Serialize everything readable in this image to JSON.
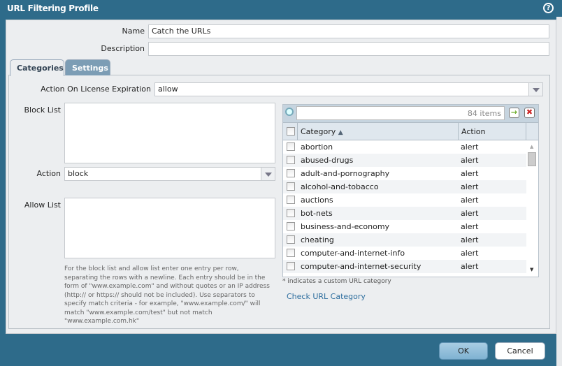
{
  "dialog": {
    "title": "URL Filtering Profile",
    "help_icon": "help-icon"
  },
  "form": {
    "name_label": "Name",
    "name_value": "Catch the URLs",
    "description_label": "Description",
    "description_value": ""
  },
  "tabs": [
    {
      "label": "Categories",
      "active": true
    },
    {
      "label": "Settings",
      "active": false
    }
  ],
  "categories_tab": {
    "license_label": "Action On License Expiration",
    "license_value": "allow",
    "block_list_label": "Block List",
    "action_label": "Action",
    "action_value": "block",
    "allow_list_label": "Allow List",
    "help_text": "For the block list and allow list enter one entry per row, separating the rows with a newline. Each entry should be in the form of \"www.example.com\" and without quotes or an IP address (http:// or https:// should not be included). Use separators to specify match criteria - for example, \"www.example.com/\" will match \"www.example.com/test\" but not match \"www.example.com.hk\"",
    "grid": {
      "item_count": "84 items",
      "col_category": "Category",
      "col_action": "Action",
      "rows": [
        {
          "category": "abortion",
          "action": "alert"
        },
        {
          "category": "abused-drugs",
          "action": "alert"
        },
        {
          "category": "adult-and-pornography",
          "action": "alert"
        },
        {
          "category": "alcohol-and-tobacco",
          "action": "alert"
        },
        {
          "category": "auctions",
          "action": "alert"
        },
        {
          "category": "bot-nets",
          "action": "alert"
        },
        {
          "category": "business-and-economy",
          "action": "alert"
        },
        {
          "category": "cheating",
          "action": "alert"
        },
        {
          "category": "computer-and-internet-info",
          "action": "alert"
        },
        {
          "category": "computer-and-internet-security",
          "action": "alert"
        }
      ]
    },
    "footnote": "* indicates a custom URL category",
    "check_link": "Check URL Category"
  },
  "footer": {
    "ok": "OK",
    "cancel": "Cancel"
  }
}
